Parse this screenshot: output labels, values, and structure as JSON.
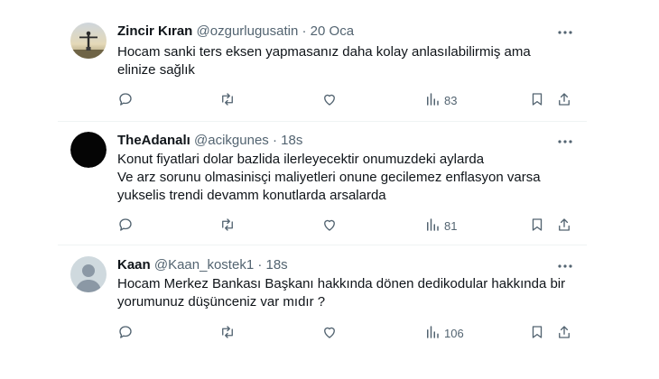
{
  "tweets": [
    {
      "name": "Zincir Kıran",
      "handle": "@ozgurlugusatin",
      "separator": "·",
      "time": "20 Oca",
      "lines": [
        "Hocam sanki ters eksen yapmasanız daha kolay anlasılabilirmiş ama",
        "elinize sağlık"
      ],
      "views": "83",
      "avatar": "statue-silhouette-photo"
    },
    {
      "name": "TheAdanalı",
      "handle": "@acikgunes",
      "separator": "·",
      "time": "18s",
      "lines": [
        "Konut fiyatlari dolar bazlida ilerleyecektir onumuzdeki aylarda",
        "Ve arz sorunu olmasinisçi maliyetleri onune gecilemez enflasyon varsa",
        "yukselis trendi devamm konutlarda arsalarda"
      ],
      "views": "81",
      "avatar": "black-circle"
    },
    {
      "name": "Kaan",
      "handle": "@Kaan_kostek1",
      "separator": "·",
      "time": "18s",
      "lines": [
        "Hocam Merkez Bankası Başkanı hakkında dönen dedikodular hakkında bir",
        "yorumunuz düşünceniz var mıdır ?"
      ],
      "views": "106",
      "avatar": "default-profile"
    }
  ],
  "icons": {
    "more": "more-horizontal-icon",
    "reply": "reply-icon",
    "retweet": "retweet-icon",
    "like": "heart-icon",
    "views": "bar-chart-icon",
    "bookmark": "bookmark-icon",
    "share": "share-icon"
  },
  "colors": {
    "text": "#0f1419",
    "secondary": "#536471",
    "divider": "#eff3f4"
  }
}
